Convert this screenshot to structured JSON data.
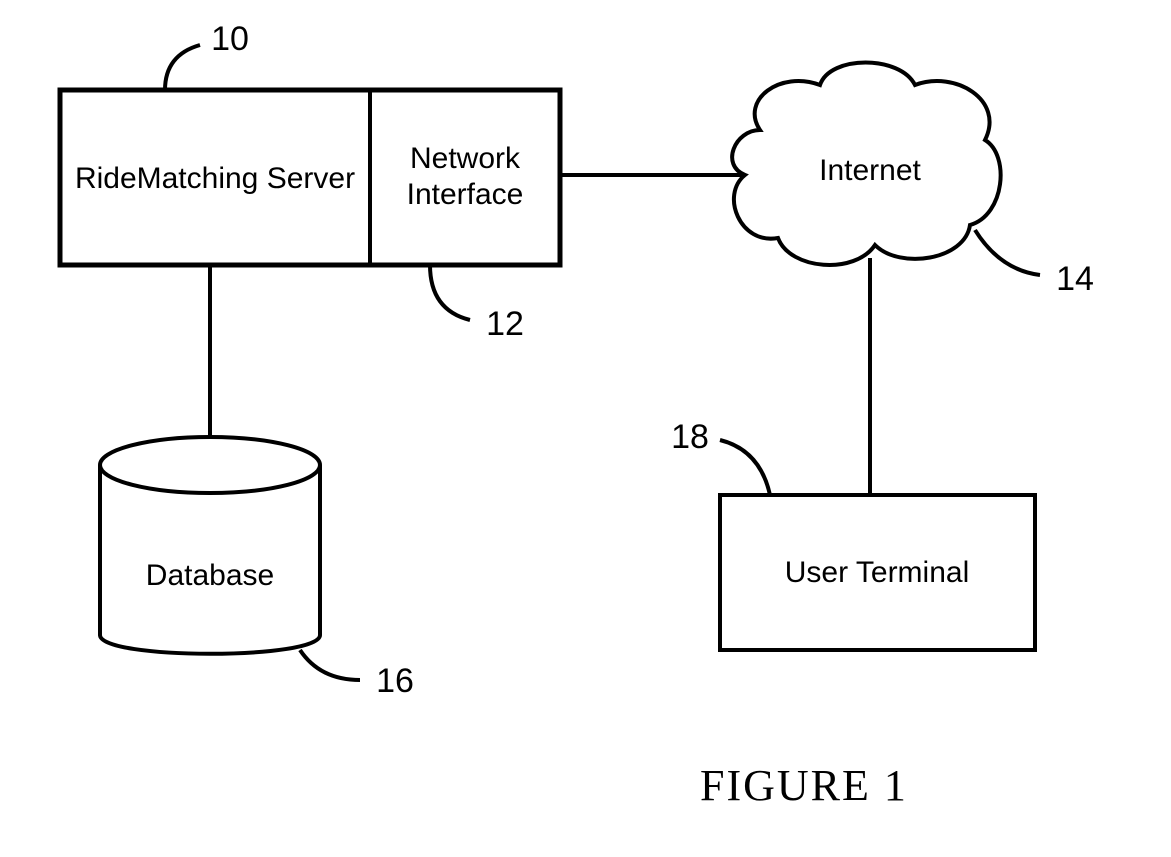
{
  "nodes": {
    "server": {
      "label": "RideMatching Server",
      "ref": "10"
    },
    "netif": {
      "label_line1": "Network",
      "label_line2": "Interface",
      "ref": "12"
    },
    "internet": {
      "label": "Internet",
      "ref": "14"
    },
    "database": {
      "label": "Database",
      "ref": "16"
    },
    "terminal": {
      "label": "User Terminal",
      "ref": "18"
    }
  },
  "caption": "FIGURE 1"
}
